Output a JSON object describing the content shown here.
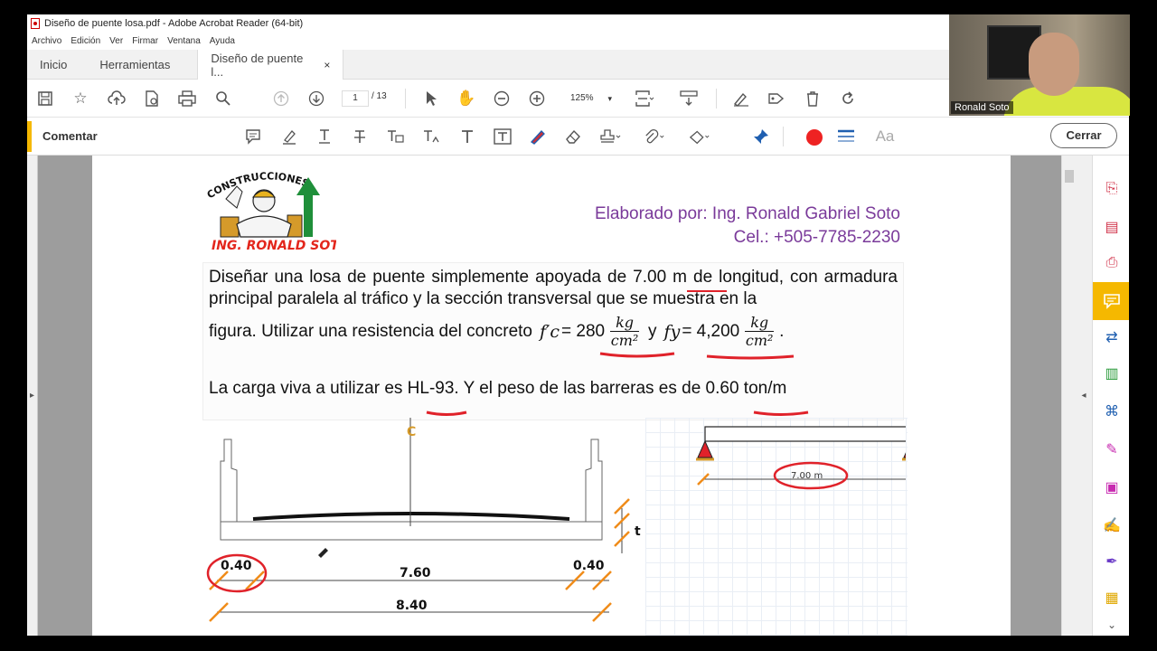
{
  "window": {
    "title": "Diseño de puente losa.pdf - Adobe Acrobat Reader (64-bit)"
  },
  "menu": [
    "Archivo",
    "Edición",
    "Ver",
    "Firmar",
    "Ventana",
    "Ayuda"
  ],
  "tabs": {
    "home": "Inicio",
    "tools": "Herramientas",
    "document": "Diseño de puente l...",
    "close": "×"
  },
  "toolbar": {
    "page_current": "1",
    "page_total": "/ 13",
    "zoom": "125%"
  },
  "comment_bar": {
    "label": "Comentar",
    "close_button": "Cerrar",
    "font_label": "Aa",
    "accent_color": "#f5b800"
  },
  "document": {
    "logo_top_text": "CONSTRUCCIONES",
    "logo_bottom_text": "ING. RONALD SOTO",
    "author_line1": "Elaborado por: Ing. Ronald Gabriel Soto",
    "author_line2": "Cel.: +505-7785-2230",
    "paragraph": "Diseñar una losa de puente simplemente apoyada de 7.00 m de longitud, con armadura principal paralela al tráfico y la sección transversal que se muestra en la",
    "formula_prefix": "figura. Utilizar una resistencia del concreto",
    "fc_symbol": "f′c",
    "fc_value": "= 280",
    "kg": "kg",
    "cm2": "cm²",
    "y_word": "y",
    "fy_symbol": "fy",
    "fy_value": "= 4,200",
    "period": ".",
    "live_load": "La carga viva a utilizar es HL-93. Y el peso de las barreras es de 0.60 ton/m",
    "section": {
      "centerline": "C",
      "thickness_label": "t",
      "left_curb": "0.40",
      "center_width": "7.60",
      "right_curb": "0.40",
      "total_width": "8.40"
    },
    "beam_span": "7.00 m"
  },
  "webcam": {
    "name": "Ronald Soto"
  }
}
